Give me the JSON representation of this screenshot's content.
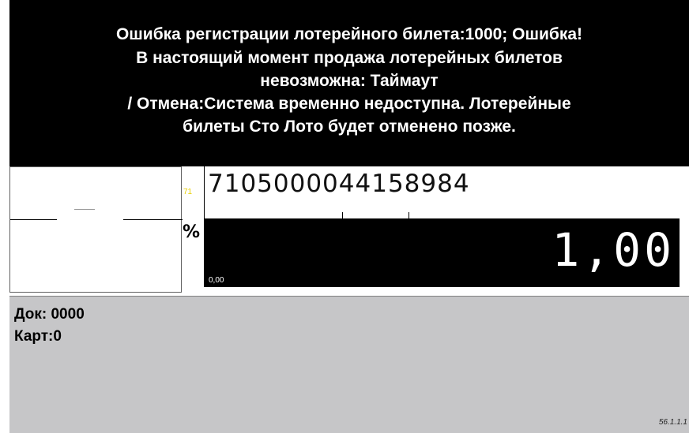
{
  "error_message": {
    "lines": [
      "Ошибка регистрации лотерейного билета:1000;  Ошибка!",
      "В настоящий момент продажа лотерейных билетов",
      "невозможна: Таймаут",
      "/ Отмена:Система временно недоступна. Лотерейные",
      "билеты Сто Лото будет отменено позже."
    ]
  },
  "pos": {
    "small_code": "71",
    "barcode": "7105000044158984",
    "amount": "1,00",
    "amount_sub": "0,00",
    "percent_icon": "percent-icon"
  },
  "info": {
    "doc": "Док: 0000",
    "card": "Карт:0"
  },
  "version": "56.1.1.1"
}
